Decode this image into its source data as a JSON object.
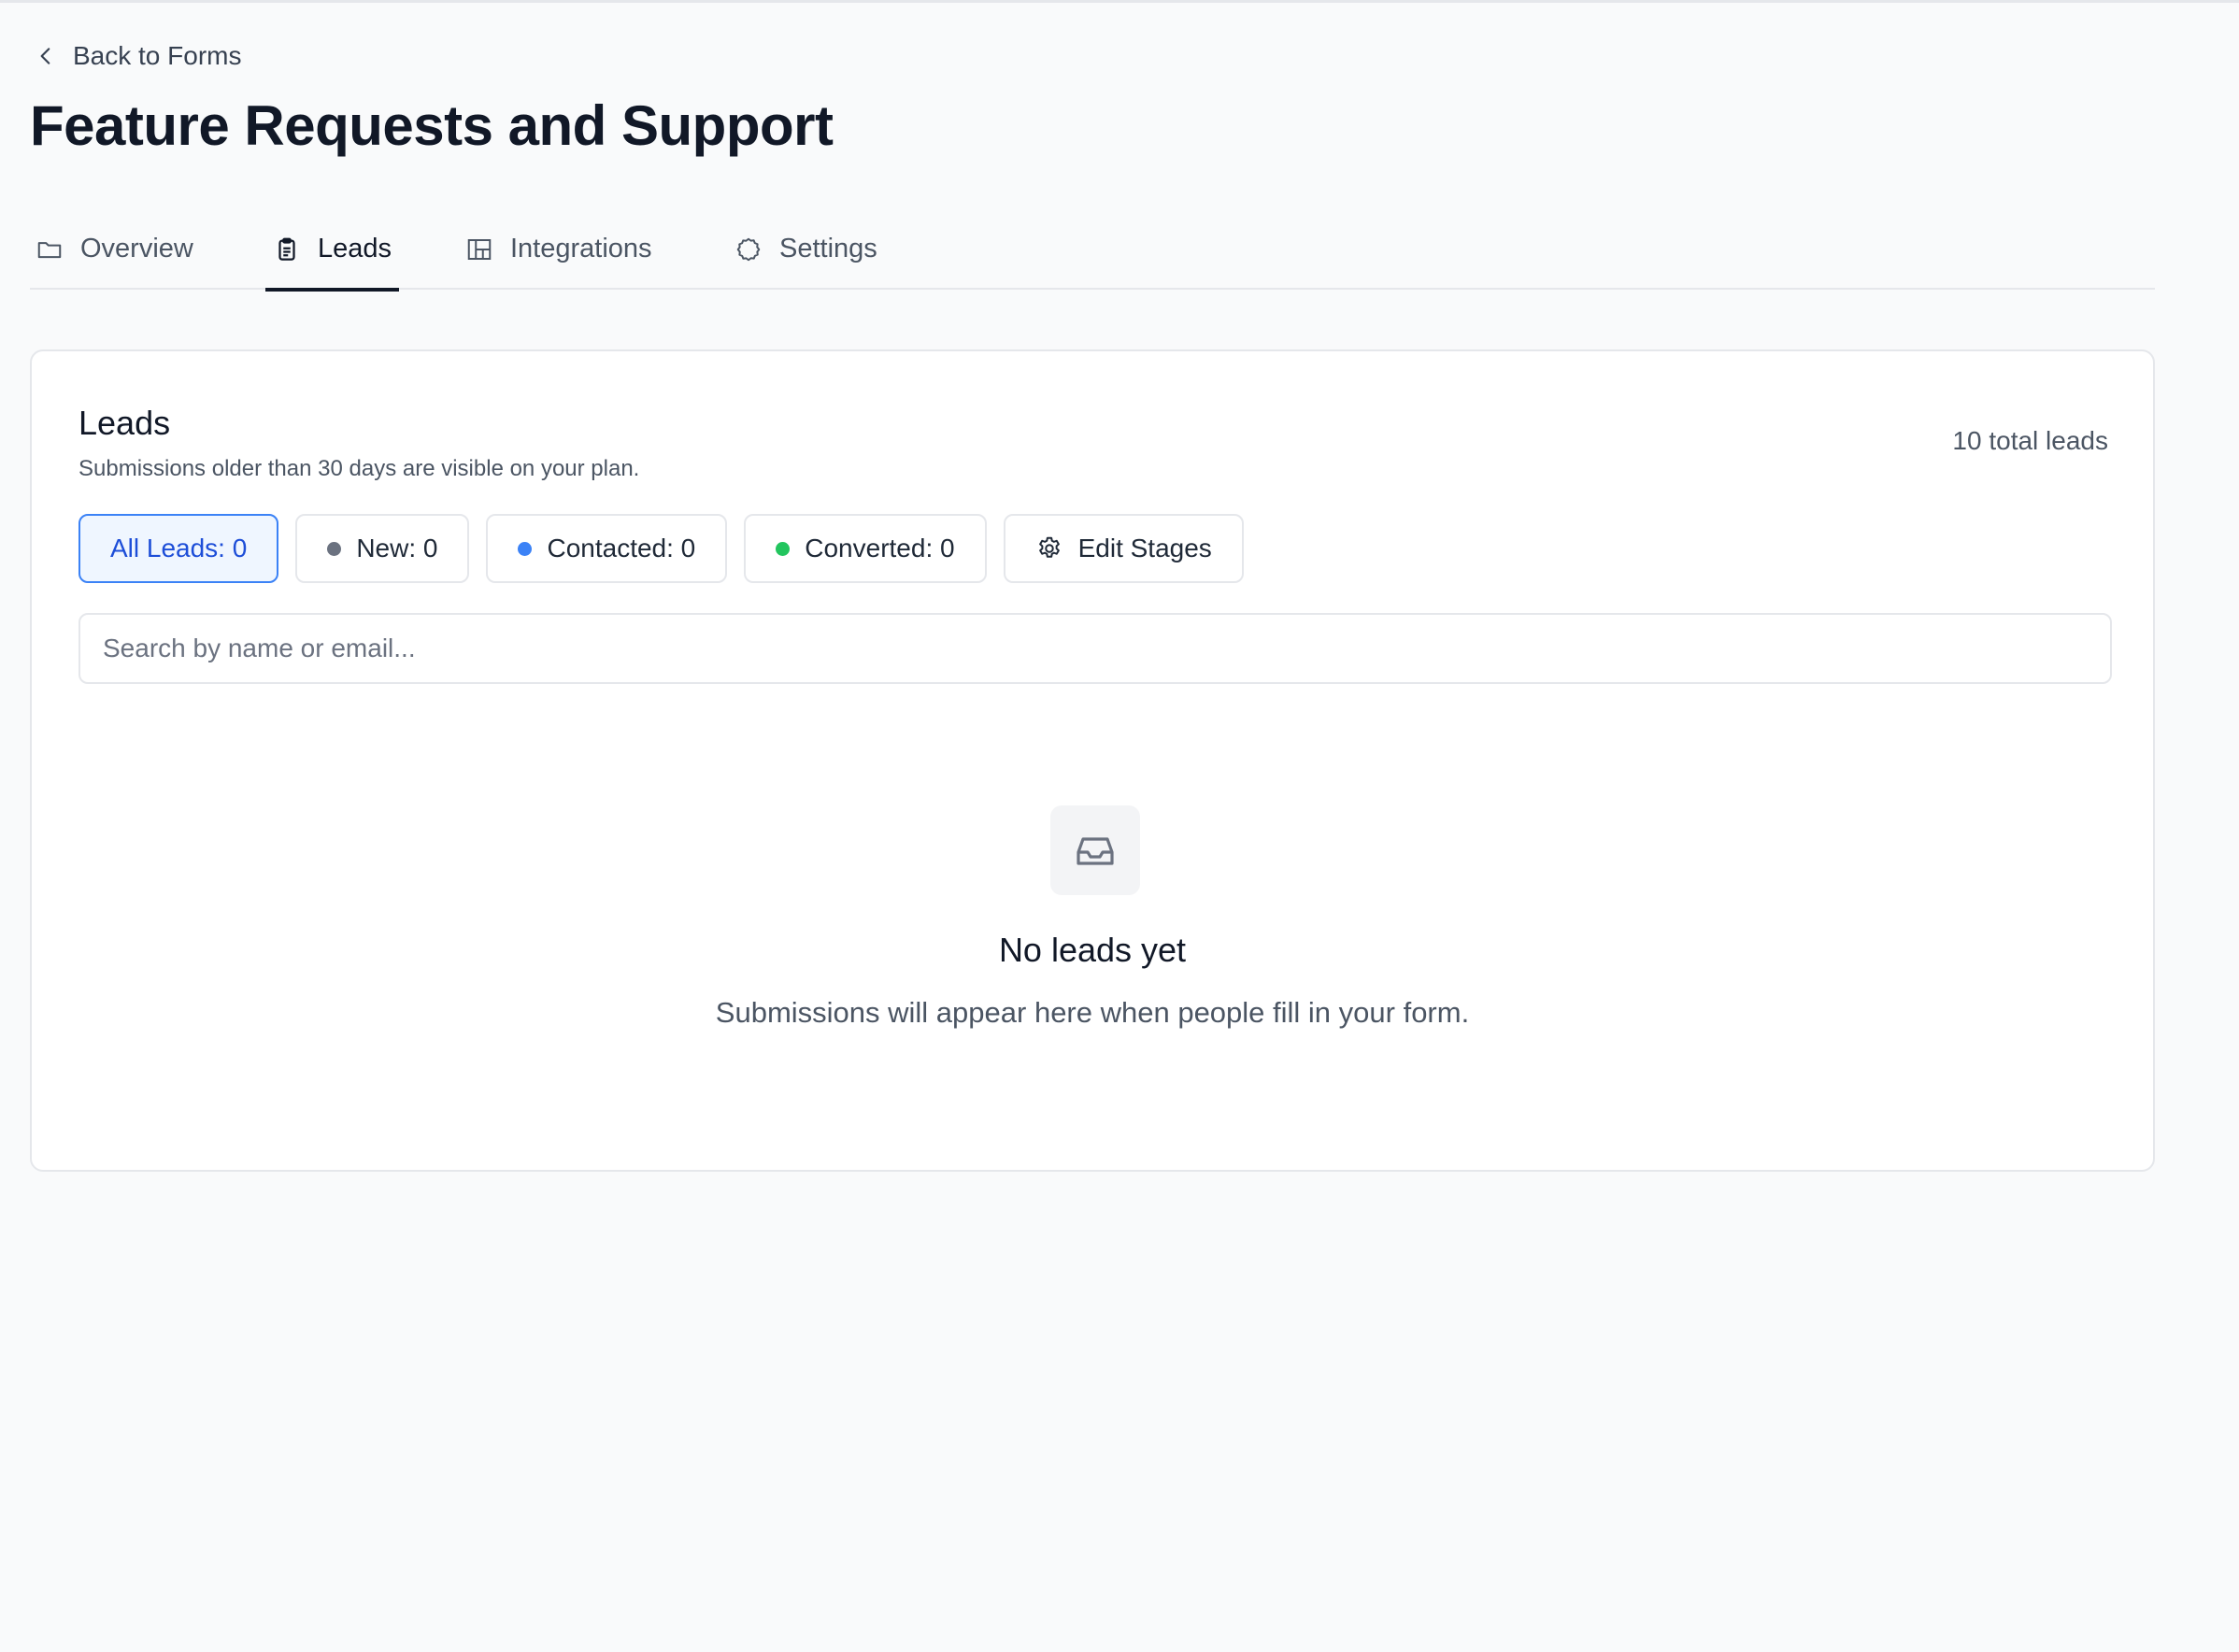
{
  "header": {
    "back_label": "Back to Forms",
    "page_title": "Feature Requests and Support"
  },
  "tabs": [
    {
      "label": "Overview",
      "icon": "folder-icon"
    },
    {
      "label": "Leads",
      "icon": "clipboard-icon",
      "active": true
    },
    {
      "label": "Integrations",
      "icon": "layout-icon"
    },
    {
      "label": "Settings",
      "icon": "gear-icon"
    }
  ],
  "leads_card": {
    "title": "Leads",
    "subtitle": "Submissions older than 30 days are visible on your plan.",
    "total": "10 total leads",
    "filters": [
      {
        "label": "All Leads: 0",
        "active": true
      },
      {
        "label": "New: 0",
        "dot_color": "#6b7280"
      },
      {
        "label": "Contacted: 0",
        "dot_color": "#3b82f6"
      },
      {
        "label": "Converted: 0",
        "dot_color": "#22c55e"
      }
    ],
    "edit_stages_label": "Edit Stages",
    "search_placeholder": "Search by name or email...",
    "empty_state": {
      "icon": "inbox-icon",
      "title": "No leads yet",
      "message": "Submissions will appear here when people fill in your form."
    }
  },
  "colors": {
    "accent": "#3b82f6",
    "active_tab": "#111827",
    "background": "#f9fafb"
  }
}
